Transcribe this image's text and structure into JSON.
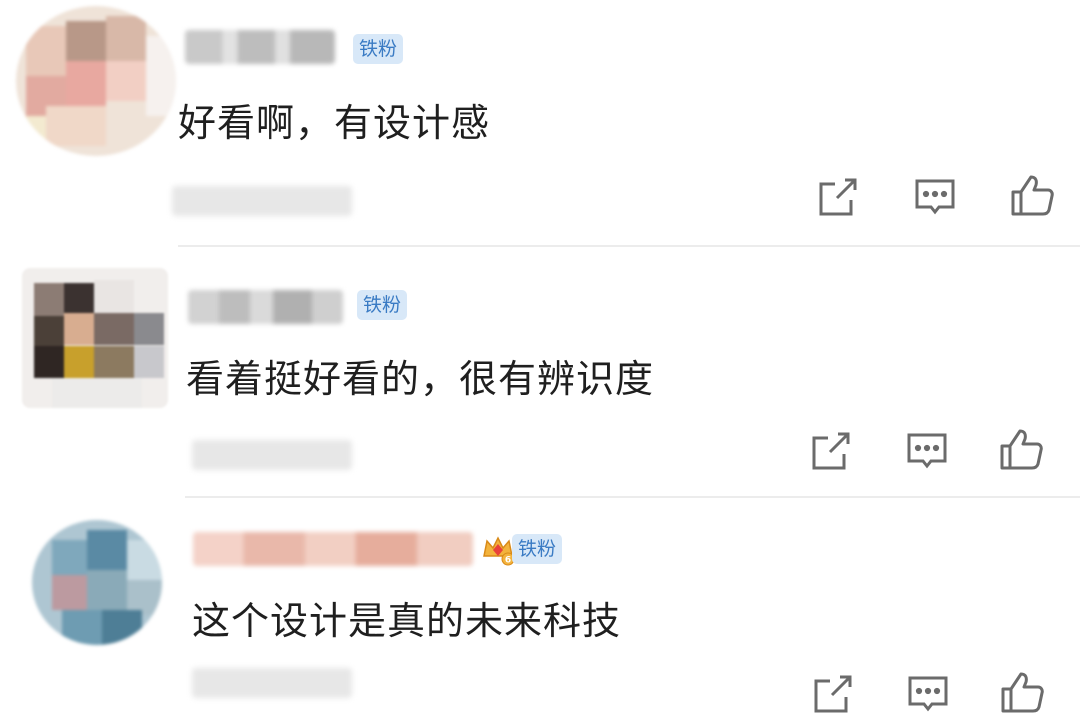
{
  "badge_label": "铁粉",
  "comments": [
    {
      "text": "好看啊，有设计感"
    },
    {
      "text": "看着挺好看的，很有辨识度"
    },
    {
      "text": "这个设计是真的未来科技",
      "crown_level": "6"
    }
  ],
  "icons": {
    "share": "share-icon",
    "reply": "comment-icon",
    "like": "thumb-up-icon"
  },
  "colors": {
    "badge_bg": "#d8e8f8",
    "badge_text": "#3a7bc4",
    "icon": "#6b6b6b",
    "text": "#1f1f1f"
  }
}
